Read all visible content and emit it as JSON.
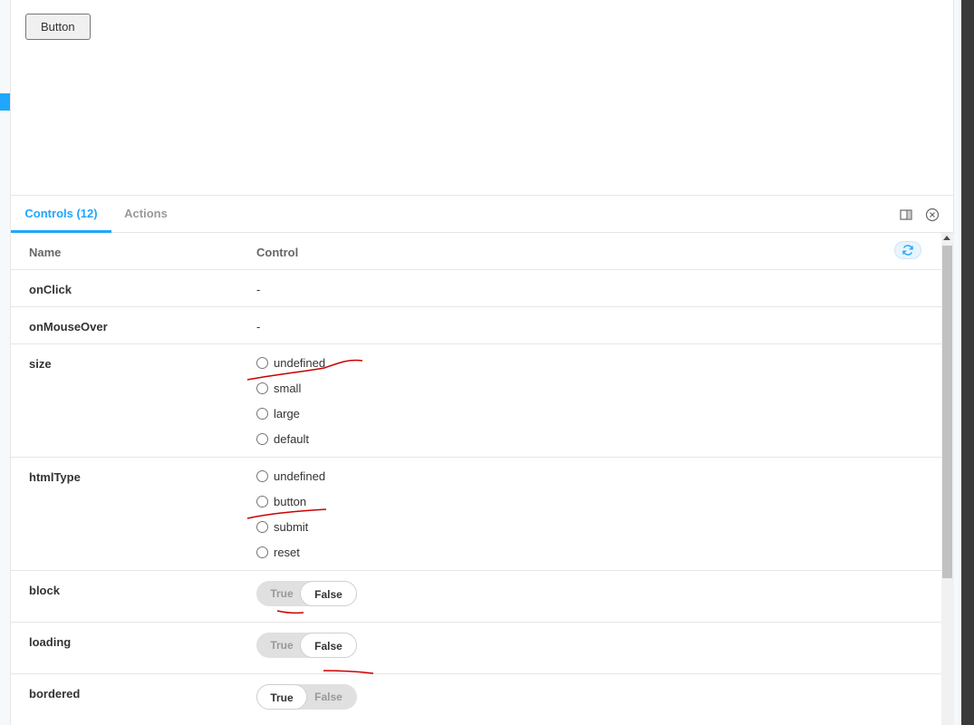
{
  "preview": {
    "button_label": "Button"
  },
  "tabs": {
    "controls_label": "Controls (12)",
    "actions_label": "Actions"
  },
  "table": {
    "name_header": "Name",
    "control_header": "Control",
    "rows": {
      "onClick": {
        "name": "onClick",
        "value": "-"
      },
      "onMouseOver": {
        "name": "onMouseOver",
        "value": "-"
      },
      "size": {
        "name": "size",
        "options": [
          "undefined",
          "small",
          "large",
          "default"
        ]
      },
      "htmlType": {
        "name": "htmlType",
        "options": [
          "undefined",
          "button",
          "submit",
          "reset"
        ]
      },
      "block": {
        "name": "block",
        "true_label": "True",
        "false_label": "False",
        "selected": "False"
      },
      "loading": {
        "name": "loading",
        "true_label": "True",
        "false_label": "False",
        "selected": "False"
      },
      "bordered": {
        "name": "bordered",
        "true_label": "True",
        "false_label": "False",
        "selected": "True"
      }
    }
  },
  "colors": {
    "accent": "#1ea7fd",
    "annotation": "#cc0000"
  },
  "icons": {
    "panel": "panel-toggle-icon",
    "close": "close-icon",
    "reset": "refresh-icon"
  }
}
